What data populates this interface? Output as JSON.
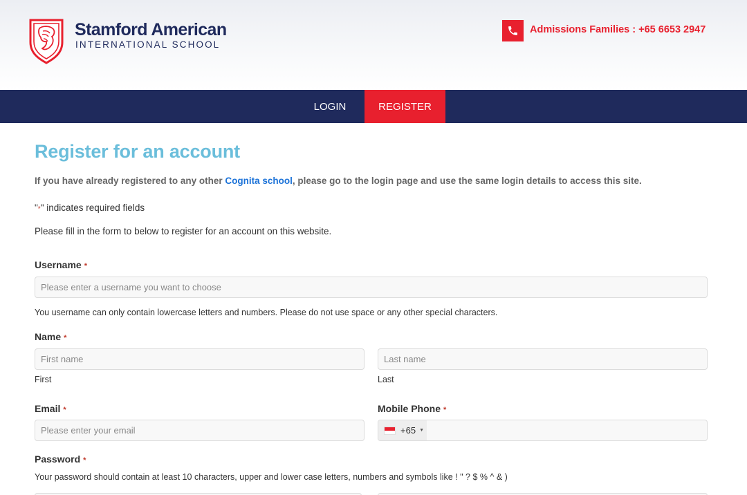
{
  "header": {
    "logo_line1": "Stamford American",
    "logo_line2": "INTERNATIONAL SCHOOL",
    "phone_text": "Admissions Families : +65 6653 2947"
  },
  "nav": {
    "login": "LOGIN",
    "register": "REGISTER"
  },
  "page": {
    "title": "Register for an account",
    "intro_before": "If you have already registered to any other ",
    "intro_link": "Cognita school",
    "intro_after": ", please go to the login page and use the same login details to access this site.",
    "required_open": "\"",
    "required_ast": "*",
    "required_close": "\" indicates required fields",
    "fill_note": "Please fill in the form to below to register for an account on this website."
  },
  "form": {
    "required_marker": "*",
    "username": {
      "label": "Username",
      "placeholder": "Please enter a username you want to choose",
      "help": "You username can only contain lowercase letters and numbers. Please do not use space or any other special characters."
    },
    "name": {
      "label": "Name",
      "first_placeholder": "First name",
      "first_sublabel": "First",
      "last_placeholder": "Last name",
      "last_sublabel": "Last"
    },
    "email": {
      "label": "Email",
      "placeholder": "Please enter your email"
    },
    "mobile": {
      "label": "Mobile Phone",
      "dial_code": "+65"
    },
    "password": {
      "label": "Password",
      "help": "Your password should contain at least 10 characters, upper and lower case letters, numbers and symbols like ! \" ? $ % ^ & )"
    }
  },
  "colors": {
    "brand_navy": "#1f2a5c",
    "brand_red": "#e8202e",
    "title_blue": "#6bbedb",
    "link_blue": "#1b72d8"
  }
}
